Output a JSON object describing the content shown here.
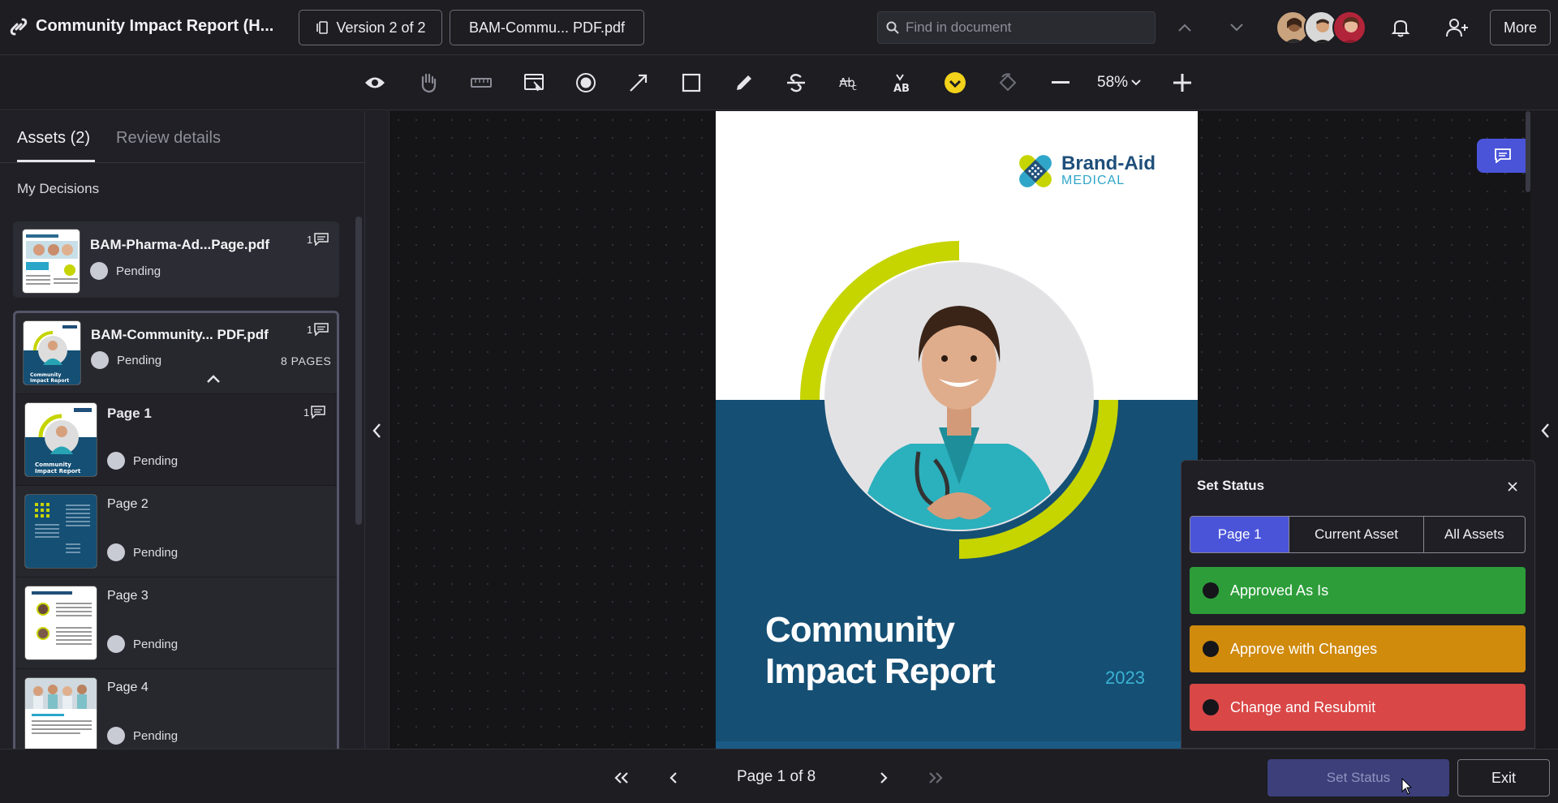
{
  "header": {
    "title": "Community Impact Report (H...",
    "version_label": "Version 2 of 2",
    "file_label": "BAM-Commu... PDF.pdf",
    "search_placeholder": "Find in document",
    "more_label": "More"
  },
  "toolbar": {
    "tools": [
      "eye-icon",
      "hand-icon",
      "ruler-icon",
      "select-area-icon",
      "record-icon",
      "arrow-icon",
      "rectangle-icon",
      "pencil-icon",
      "strikethrough-icon",
      "replace-text-icon",
      "insert-text-icon",
      "highlight-icon",
      "rotate-icon",
      "zoom-out-icon",
      "zoom-in-icon"
    ],
    "zoom": "58%"
  },
  "sidebar": {
    "tabs": [
      {
        "label": "Assets (2)",
        "active": true
      },
      {
        "label": "Review details",
        "active": false
      }
    ],
    "section_title": "My Decisions",
    "assets": [
      {
        "name": "BAM-Pharma-Ad...Page.pdf",
        "status": "Pending",
        "comments": "1"
      },
      {
        "name": "BAM-Community... PDF.pdf",
        "status": "Pending",
        "comments": "1",
        "pages": "8 PAGES",
        "page_list": [
          {
            "label": "Page 1",
            "status": "Pending",
            "comments": "1",
            "selected": true
          },
          {
            "label": "Page 2",
            "status": "Pending"
          },
          {
            "label": "Page 3",
            "status": "Pending"
          },
          {
            "label": "Page 4",
            "status": "Pending"
          }
        ]
      }
    ]
  },
  "document": {
    "brand_name": "Brand-Aid",
    "brand_sub": "MEDICAL",
    "title_line1": "Community",
    "title_line2": "Impact Report",
    "year": "2023",
    "colors": {
      "navy": "#154f74",
      "lime": "#c6d400",
      "teal": "#3bb3d4"
    }
  },
  "set_status": {
    "title": "Set Status",
    "scope_tabs": [
      {
        "label": "Page 1",
        "active": true
      },
      {
        "label": "Current Asset",
        "active": false
      },
      {
        "label": "All Assets",
        "active": false
      }
    ],
    "options": [
      {
        "label": "Approved As Is",
        "color": "#2d9d3a"
      },
      {
        "label": "Approve with Changes",
        "color": "#d08a0c"
      },
      {
        "label": "Change and Resubmit",
        "color": "#d94747"
      }
    ]
  },
  "footer": {
    "page_indicator": "Page 1 of 8",
    "set_status_label": "Set Status",
    "exit_label": "Exit"
  }
}
